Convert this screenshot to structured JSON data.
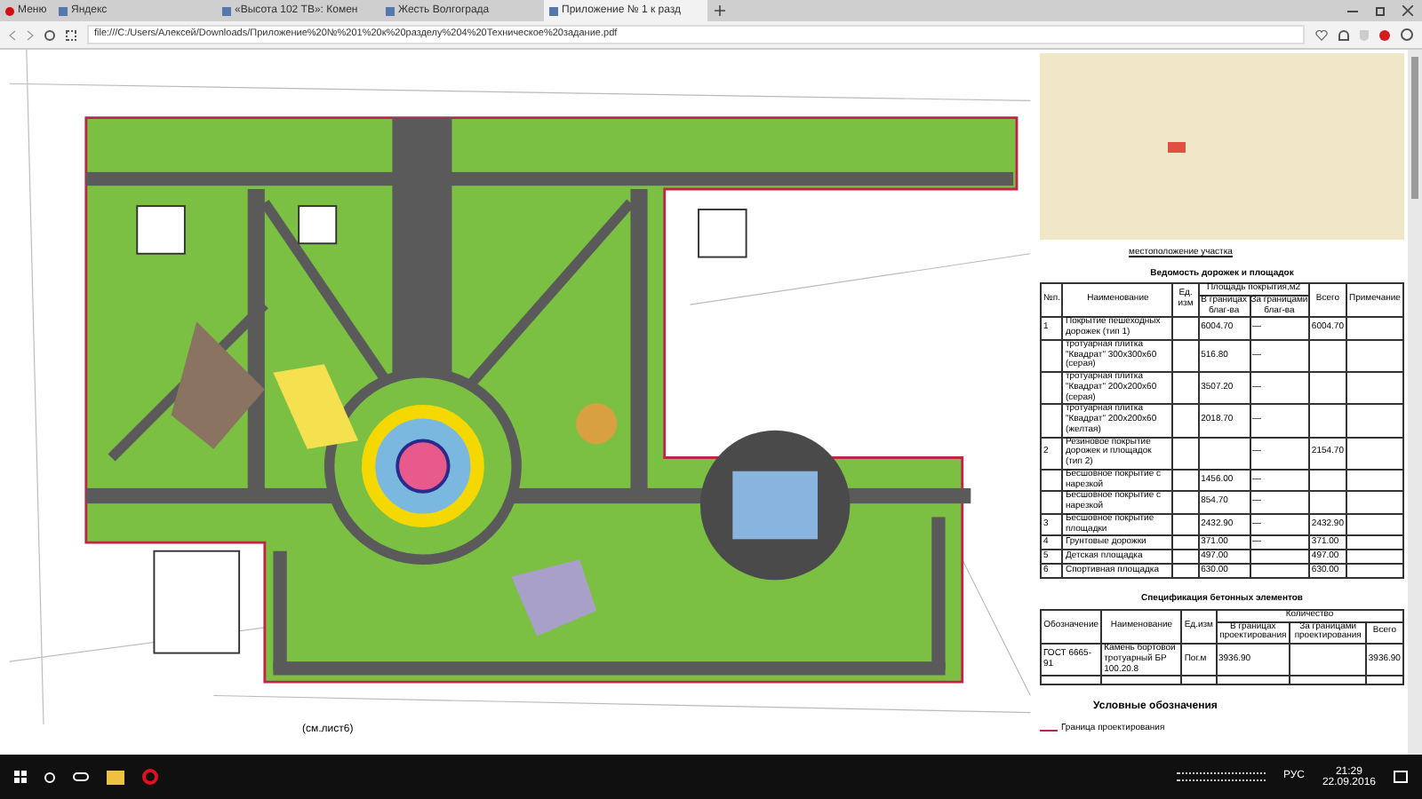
{
  "tabs": [
    {
      "label": "Меню",
      "kind": "menu",
      "selected": false
    },
    {
      "label": "Яндекс",
      "kind": "page",
      "selected": false
    },
    {
      "label": "«Высота 102 ТВ»: Комен",
      "kind": "page",
      "selected": false
    },
    {
      "label": "Жесть Волгограда",
      "kind": "page",
      "selected": false
    },
    {
      "label": "Приложение № 1 к разд",
      "kind": "page",
      "selected": true
    }
  ],
  "address_bar": {
    "url": "file:///C:/Users/Алексей/Downloads/Приложение%20№%201%20к%20разделу%204%20Техническое%20задание.pdf"
  },
  "plan": {
    "sheet_ref": "(см.лист6)"
  },
  "map": {
    "caption": "местоположение участка"
  },
  "roads_table": {
    "title": "Ведомость дорожек и площадок",
    "columns": [
      {
        "label": "№п."
      },
      {
        "label": "Наименование"
      },
      {
        "label": "Ед. изм"
      },
      {
        "label": "Площадь покрытия,м2",
        "colspan": 2,
        "subcolumns": [
          "В границах благ-ва",
          "За границами благ-ва"
        ]
      },
      {
        "label": "Всего"
      },
      {
        "label": "Примечание"
      }
    ],
    "rows": [
      {
        "cells": [
          "1",
          "Покрытие пешеходных дорожек (тип 1)",
          "",
          "6004.70",
          "—",
          "6004.70",
          ""
        ]
      },
      {
        "cells": [
          "",
          "тротуарная плитка \"Квадрат\" 300x300x60 (серая)",
          "",
          "516.80",
          "—",
          "",
          ""
        ]
      },
      {
        "cells": [
          "",
          "тротуарная плитка \"Квадрат\" 200x200x60 (серая)",
          "",
          "3507.20",
          "—",
          "",
          ""
        ]
      },
      {
        "cells": [
          "",
          "тротуарная плитка \"Квадрат\" 200x200x60 (желтая)",
          "",
          "2018.70",
          "—",
          "",
          ""
        ]
      },
      {
        "cells": [
          "2",
          "Резиновое покрытие дорожек и площадок (тип 2)",
          "",
          "",
          "—",
          "2154.70",
          ""
        ]
      },
      {
        "cells": [
          "",
          "Бесшовное покрытие с нарезкой",
          "",
          "1456.00",
          "—",
          "",
          ""
        ]
      },
      {
        "cells": [
          "",
          "Бесшовное покрытие с нарезкой",
          "",
          "854.70",
          "—",
          "",
          ""
        ]
      },
      {
        "cells": [
          "3",
          "Бесшовное покрытие площадки",
          "",
          "2432.90",
          "—",
          "2432.90",
          ""
        ]
      },
      {
        "cells": [
          "4",
          "Грунтовые дорожки",
          "",
          "371.00",
          "—",
          "371.00",
          ""
        ]
      },
      {
        "cells": [
          "5",
          "Детская площадка",
          "",
          "497.00",
          "",
          "497.00",
          ""
        ]
      },
      {
        "cells": [
          "6",
          "Спортивная площадка",
          "",
          "630.00",
          "",
          "630.00",
          ""
        ]
      }
    ]
  },
  "spec_table": {
    "title": "Спецификация бетонных элементов",
    "columns": [
      {
        "label": "Обозначение"
      },
      {
        "label": "Наименование"
      },
      {
        "label": "Ед.изм"
      },
      {
        "label": "Количество",
        "colspan": 3,
        "subcolumns": [
          "В границах проектирования",
          "За границами проектирования",
          "Всего"
        ]
      }
    ],
    "rows": [
      {
        "cells": [
          "ГОСТ 6665-91",
          "Камень бортовой тротуарный БР 100.20.8",
          "Пог.м",
          "3936.90",
          "",
          "3936.90"
        ]
      }
    ]
  },
  "legend": {
    "title": "Условные обозначения",
    "items": [
      {
        "label": "Граница проектирования"
      }
    ]
  },
  "tray": {
    "language": "РУС",
    "time": "21:29",
    "date": "22.09.2016"
  }
}
